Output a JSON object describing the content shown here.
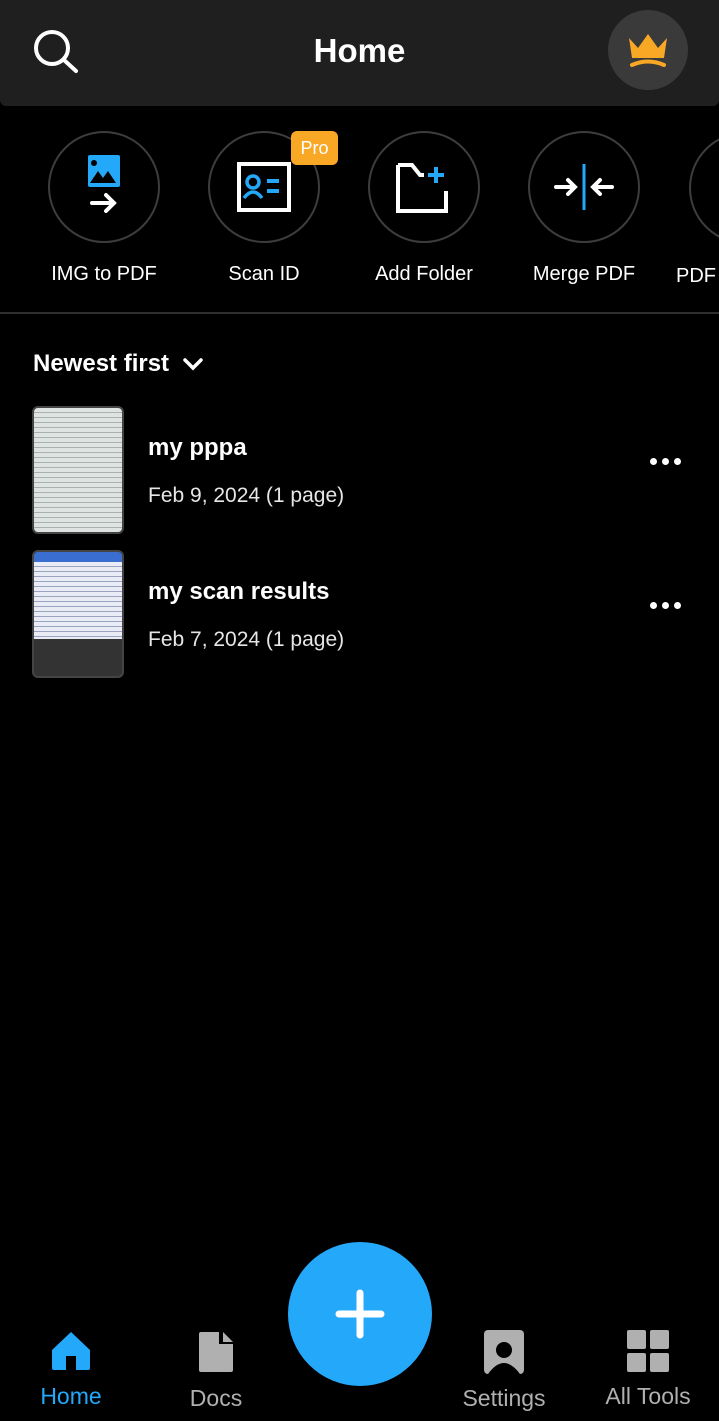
{
  "header": {
    "title": "Home"
  },
  "tools": [
    {
      "label": "IMG to PDF",
      "icon": "image-to-pdf-icon"
    },
    {
      "label": "Scan ID",
      "icon": "id-card-icon",
      "badge": "Pro"
    },
    {
      "label": "Add Folder",
      "icon": "add-folder-icon"
    },
    {
      "label": "Merge PDF",
      "icon": "merge-icon"
    },
    {
      "label": "PDF",
      "icon": "pdf-icon"
    }
  ],
  "sort": {
    "label": "Newest first"
  },
  "documents": [
    {
      "name": "my pppa",
      "meta": "Feb 9, 2024 (1 page)"
    },
    {
      "name": "my scan results",
      "meta": "Feb 7, 2024 (1 page)"
    }
  ],
  "nav": {
    "home": "Home",
    "docs": "Docs",
    "settings": "Settings",
    "all_tools": "All Tools"
  },
  "colors": {
    "accent": "#24a9fa",
    "pro": "#f9a825",
    "crown": "#f9a825"
  }
}
